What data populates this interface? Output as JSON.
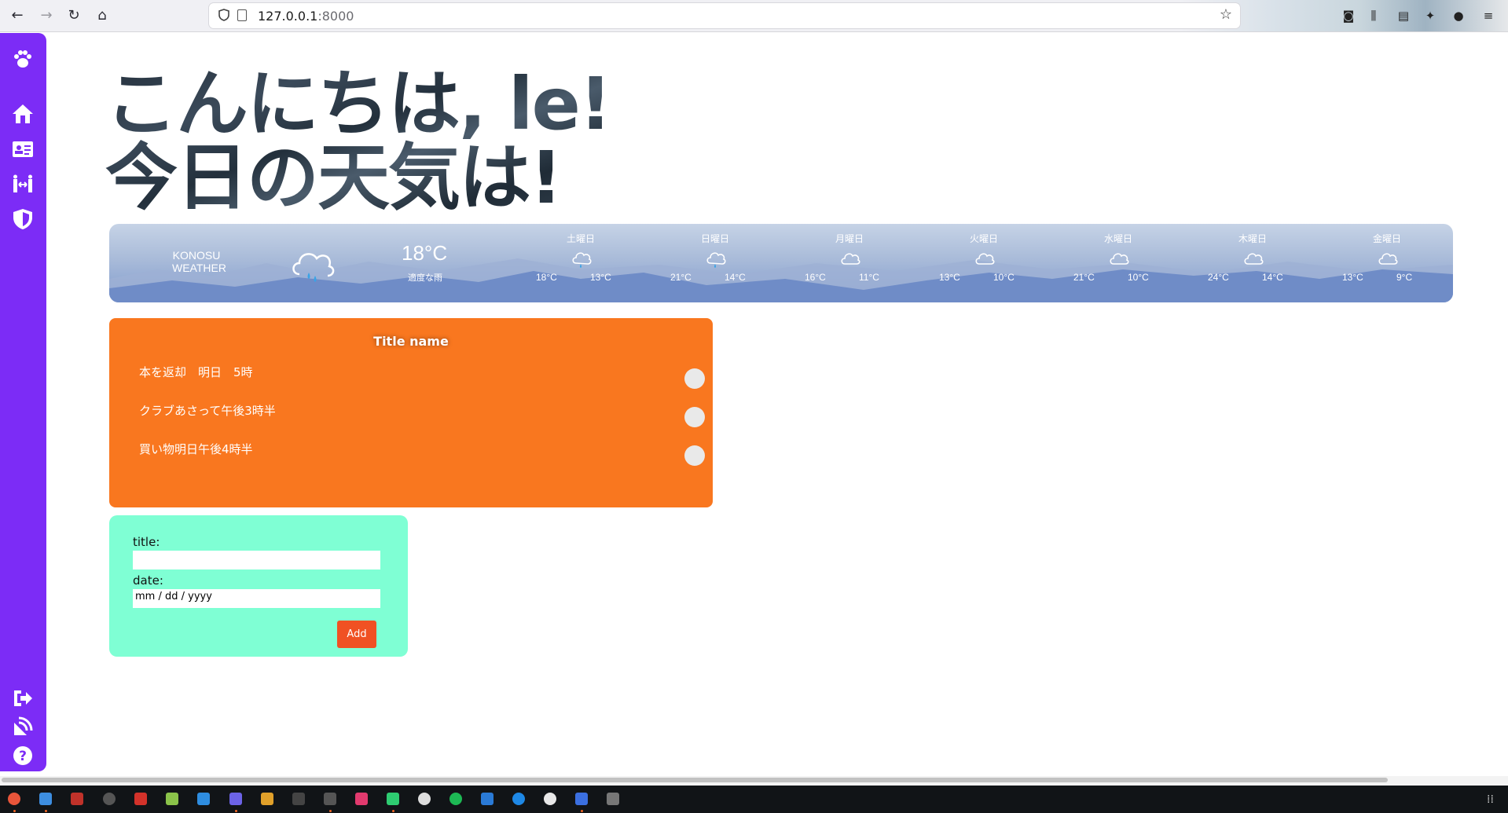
{
  "browser": {
    "url_host": "127.0.0.1",
    "url_port": ":8000"
  },
  "heading": {
    "line1": "こんにちは, le!",
    "line2": "今日の天気は!"
  },
  "weather": {
    "city": "KONOSU",
    "label": "WEATHER",
    "current_temp": "18°C",
    "current_desc": "適度な雨",
    "days": [
      {
        "name": "土曜日",
        "icon": "rain-cloud-icon",
        "high": "18°C",
        "low": "13°C"
      },
      {
        "name": "日曜日",
        "icon": "rain-cloud-icon",
        "high": "21°C",
        "low": "14°C"
      },
      {
        "name": "月曜日",
        "icon": "cloud-icon",
        "high": "16°C",
        "low": "11°C"
      },
      {
        "name": "火曜日",
        "icon": "cloud-icon",
        "high": "13°C",
        "low": "10°C"
      },
      {
        "name": "水曜日",
        "icon": "cloud-icon",
        "high": "21°C",
        "low": "10°C"
      },
      {
        "name": "木曜日",
        "icon": "cloud-icon",
        "high": "24°C",
        "low": "14°C"
      },
      {
        "name": "金曜日",
        "icon": "cloud-icon",
        "high": "13°C",
        "low": "9°C"
      }
    ]
  },
  "todo": {
    "title": "Title name",
    "items": [
      {
        "text": "本を返却　明日　5時"
      },
      {
        "text": "クラブあさって午後3時半"
      },
      {
        "text": "買い物明日午後4時半"
      }
    ]
  },
  "form": {
    "title_label": "title:",
    "title_value": "",
    "date_label": "date:",
    "date_value": "mm / dd / yyyy",
    "add_label": "Add"
  },
  "colors": {
    "sidebar": "#7c2cf6",
    "todo_card": "#f9771f",
    "form_card": "#7fffd4",
    "add_button": "#f05123"
  },
  "sidebar": {
    "icons": [
      "paw-icon",
      "home-icon",
      "address-card-icon",
      "people-arrows-icon",
      "shield-icon",
      "sign-out-icon",
      "satellite-dish-icon",
      "question-icon"
    ]
  }
}
